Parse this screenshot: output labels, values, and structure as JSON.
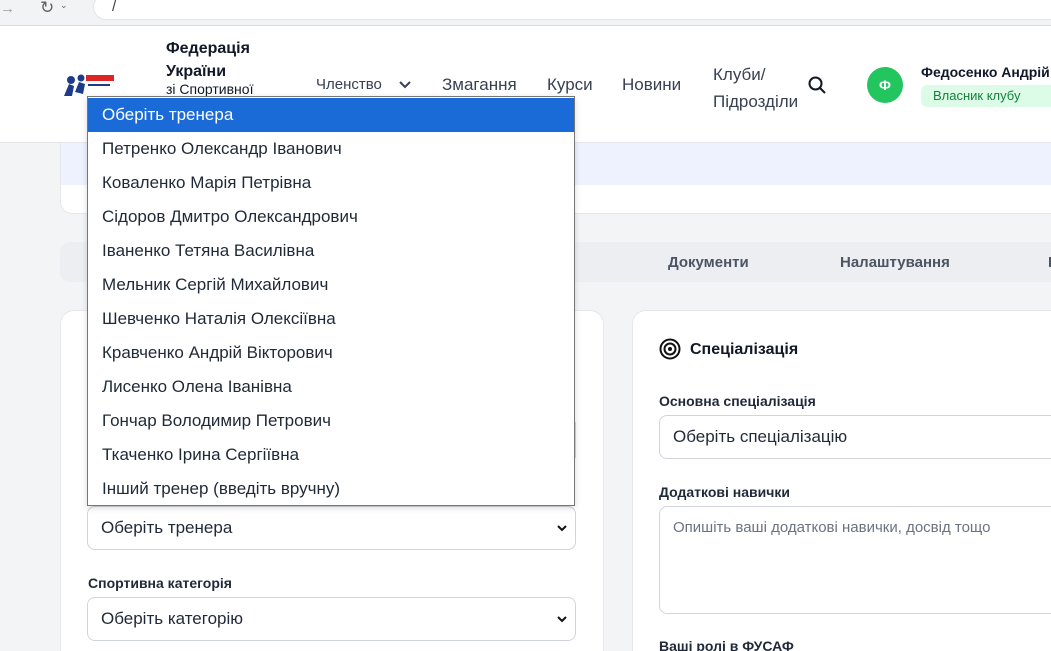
{
  "browser": {
    "address_text": "/"
  },
  "header": {
    "org_name": "Федерація України",
    "org_sub": "зі Спортивної",
    "nav": {
      "membership": "Членство",
      "competitions": "Змагання",
      "courses": "Курси",
      "news": "Новини",
      "clubs": "Клуби/ Підрозділи"
    },
    "user": {
      "initial": "Ф",
      "name": "Федосенко Андрій",
      "role": "Власник клубу"
    }
  },
  "tabs": {
    "documents": "Документи",
    "settings": "Налаштування"
  },
  "left_card": {
    "coach_select": "Оберіть тренера",
    "category_label": "Спортивна категорія",
    "category_select": "Оберіть категорію"
  },
  "right_card": {
    "title": "Спеціалізація",
    "main_spec_label": "Основна спеціалізація",
    "main_spec_select": "Оберіть спеціалізацію",
    "skills_label": "Додаткові навички",
    "skills_placeholder": "Опишіть ваші додаткові навички, досвід тощо",
    "roles_label": "Ваші ролі в ФУСАФ"
  },
  "dropdown": {
    "options": [
      "Оберіть тренера",
      "Петренко Олександр Іванович",
      "Коваленко Марія Петрівна",
      "Сідоров Дмитро Олександрович",
      "Іваненко Тетяна Василівна",
      "Мельник Сергій Михайлович",
      "Шевченко Наталія Олексіївна",
      "Кравченко Андрій Вікторович",
      "Лисенко Олена Іванівна",
      "Гончар Володимир Петрович",
      "Ткаченко Ірина Сергіївна",
      "Інший тренер (введіть вручну)"
    ],
    "selected": "Оберіть тренера"
  },
  "colors": {
    "accent": "#1a6ad8",
    "avatar": "#22c55e",
    "badge_bg": "#dcfce7",
    "badge_text": "#15803d"
  }
}
